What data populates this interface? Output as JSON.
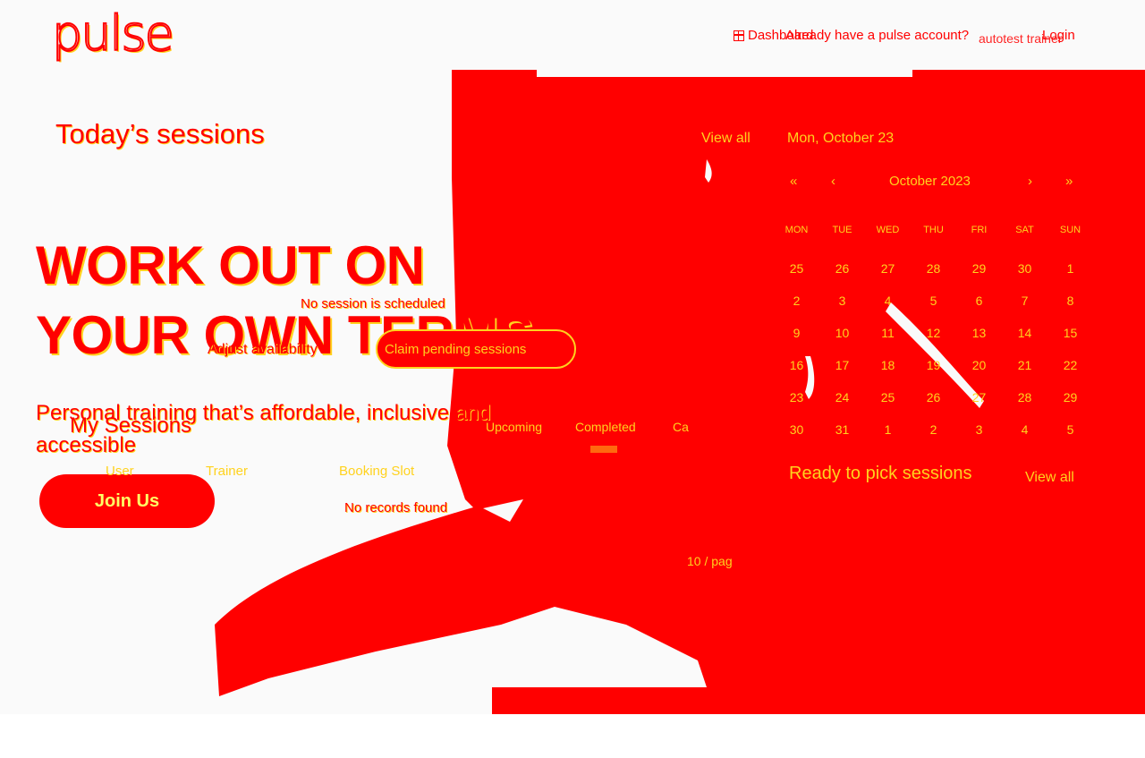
{
  "header": {
    "logo": "pulse",
    "dashboard_label": "Dashboard",
    "already_text": "Already have a pulse account?",
    "login_label": "Login",
    "username": "autotest trainer"
  },
  "hero": {
    "title_line1": "WORK OUT ON",
    "title_line2": "YOUR OWN TERMS",
    "subtitle": "Personal training that’s affordable, inclusive and accessible",
    "cta_label": "Join Us"
  },
  "today": {
    "title": "Today’s sessions",
    "view_all": "View all",
    "empty_text": "No session is scheduled",
    "adjust_label": "Adjust availability",
    "claim_label": "Claim pending sessions"
  },
  "my_sessions": {
    "title": "My Sessions",
    "tabs": [
      "Upcoming",
      "Completed",
      "Ca"
    ],
    "columns": [
      "User",
      "Trainer",
      "Booking Slot"
    ],
    "empty_text": "No records found",
    "per_page": "10 / pag"
  },
  "calendar": {
    "selected_date": "Mon, October 23",
    "month_label": "October 2023",
    "nav": {
      "prev_year": "«",
      "prev_month": "‹",
      "next_month": "›",
      "next_year": "»"
    },
    "weekdays": [
      "MON",
      "TUE",
      "WED",
      "THU",
      "FRI",
      "SAT",
      "SUN"
    ],
    "days": [
      "25",
      "26",
      "27",
      "28",
      "29",
      "30",
      "1",
      "2",
      "3",
      "4",
      "5",
      "6",
      "7",
      "8",
      "9",
      "10",
      "11",
      "12",
      "13",
      "14",
      "15",
      "16",
      "17",
      "18",
      "19",
      "20",
      "21",
      "22",
      "23",
      "24",
      "25",
      "26",
      "27",
      "28",
      "29",
      "30",
      "31",
      "1",
      "2",
      "3",
      "4",
      "5"
    ]
  },
  "ready": {
    "title": "Ready to pick sessions",
    "view_all": "View all"
  },
  "colors": {
    "primary": "#ff0000",
    "accent": "#ffd21e",
    "background": "#fafafa"
  }
}
